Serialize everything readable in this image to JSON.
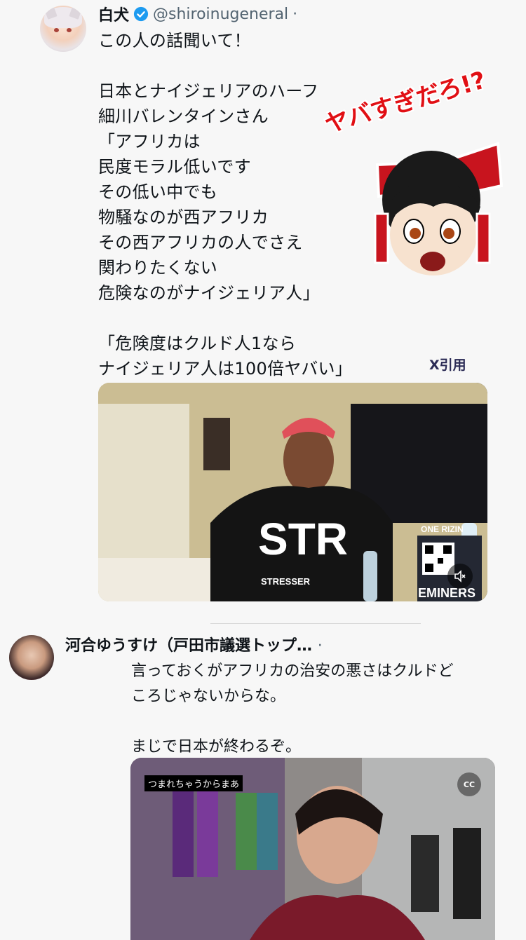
{
  "tweet1": {
    "display_name": "白犬",
    "handle": "@shiroinugeneral",
    "separator": "·",
    "text_html_lines": [
      {
        "t": "この人の話聞いて！"
      },
      {
        "t": ""
      },
      {
        "t": "日本とナイジェリアのハーフ"
      },
      {
        "t": "細川バレンタインさん"
      },
      {
        "t": "「アフリカは"
      },
      {
        "t": "民度モラル低いです"
      },
      {
        "t": "その低い中でも"
      },
      {
        "t": "物騒なのが西アフリカ"
      },
      {
        "t": "その西アフリカの人でさえ"
      },
      {
        "t": "関わりたくない"
      },
      {
        "t": "危険なのがナイジェリア人」"
      },
      {
        "t": ""
      },
      {
        "t": "「危険度はクルド人1なら"
      },
      {
        "t": "ナイジェリア人は100倍ヤバい」"
      }
    ],
    "stamp_text": "ヤバすぎだろ!?",
    "quote_label": "X引用",
    "video_shirt_text": "STR",
    "video_shirt_sub": "STRESSER",
    "video_sponsor_line1": "ONE RIZIN",
    "video_sponsor_line2": "EMINERS"
  },
  "tweet2": {
    "display_name": "河合ゆうすけ（戸田市議選トップ…",
    "separator": "·",
    "text_lines": [
      "言っておくがアフリカの治安の悪さはクルドど",
      "ころじゃないからな。",
      "",
      "まじで日本が終わるぞ。"
    ],
    "video_caption": "つまれちゃうからまあ",
    "cc_label": "CC"
  },
  "colors": {
    "verified_badge": "#1d9bf0",
    "stamp_red": "#e10f14",
    "text_main": "#0f1419",
    "text_secondary": "#536471"
  }
}
